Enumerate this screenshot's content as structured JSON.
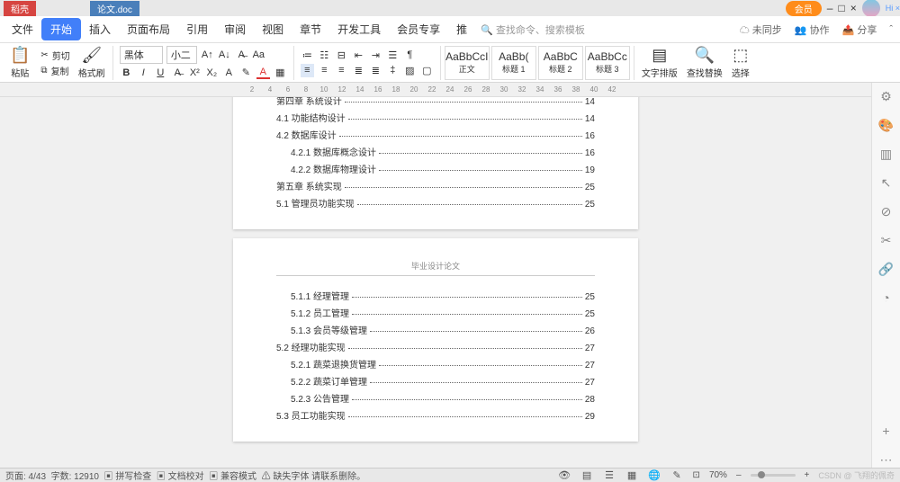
{
  "titlebar": {
    "tab1": "稻壳",
    "tab2": "论文.doc",
    "hi": "Hi ×",
    "orange": "会员"
  },
  "menu": {
    "items": [
      "文件",
      "开始",
      "插入",
      "页面布局",
      "引用",
      "审阅",
      "视图",
      "章节",
      "开发工具",
      "会员专享",
      "推"
    ],
    "active_index": 1,
    "search_hint": "查找命令、搜索模板",
    "right": {
      "sync": "未同步",
      "coop": "协作",
      "share": "分享"
    }
  },
  "ribbon": {
    "paste": "粘贴",
    "cut": "剪切",
    "copy": "复制",
    "brush": "格式刷",
    "font": "黑体",
    "size": "小二",
    "styles": [
      {
        "preview": "AaBbCcI",
        "label": "正文"
      },
      {
        "preview": "AaBb(",
        "label": "标题 1"
      },
      {
        "preview": "AaBbC",
        "label": "标题 2"
      },
      {
        "preview": "AaBbCc",
        "label": "标题 3"
      }
    ],
    "layout": "文字排版",
    "findreplace": "查找替换",
    "select": "选择"
  },
  "ruler_ticks": [
    "2",
    "4",
    "6",
    "8",
    "10",
    "12",
    "14",
    "16",
    "18",
    "20",
    "22",
    "24",
    "26",
    "28",
    "30",
    "32",
    "34",
    "36",
    "38",
    "40",
    "42"
  ],
  "doc": {
    "page2_header": "毕业设计论文",
    "toc_p1": [
      {
        "t": "第四章  系统设计",
        "p": "14",
        "cls": ""
      },
      {
        "t": "4.1 功能结构设计",
        "p": "14",
        "cls": ""
      },
      {
        "t": "4.2  数据库设计",
        "p": "16",
        "cls": ""
      },
      {
        "t": "4.2.1  数据库概念设计",
        "p": "16",
        "cls": "indent1"
      },
      {
        "t": "4.2.2  数据库物理设计",
        "p": "19",
        "cls": "indent1"
      },
      {
        "t": "第五章  系统实现",
        "p": "25",
        "cls": ""
      },
      {
        "t": "5.1 管理员功能实现",
        "p": "25",
        "cls": ""
      }
    ],
    "toc_p2": [
      {
        "t": "5.1.1  经理管理",
        "p": "25",
        "cls": "indent1"
      },
      {
        "t": "5.1.2  员工管理",
        "p": "25",
        "cls": "indent1"
      },
      {
        "t": "5.1.3  会员等级管理",
        "p": "26",
        "cls": "indent1"
      },
      {
        "t": "5.2 经理功能实现",
        "p": "27",
        "cls": ""
      },
      {
        "t": "5.2.1  蔬菜退换货管理",
        "p": "27",
        "cls": "indent1"
      },
      {
        "t": "5.2.2  蔬菜订单管理",
        "p": "27",
        "cls": "indent1"
      },
      {
        "t": "5.2.3  公告管理",
        "p": "28",
        "cls": "indent1"
      },
      {
        "t": "5.3 员工功能实现",
        "p": "29",
        "cls": ""
      }
    ]
  },
  "status": {
    "page": "页面: 4/43",
    "words": "字数: 12910",
    "spell": "拼写检查",
    "docfix": "文档校对",
    "compat": "兼容模式",
    "missing": "缺失字体",
    "note": "请联系删除。",
    "zoom": "70%",
    "csdn": "CSDN @ 飞翔的佩奇"
  }
}
